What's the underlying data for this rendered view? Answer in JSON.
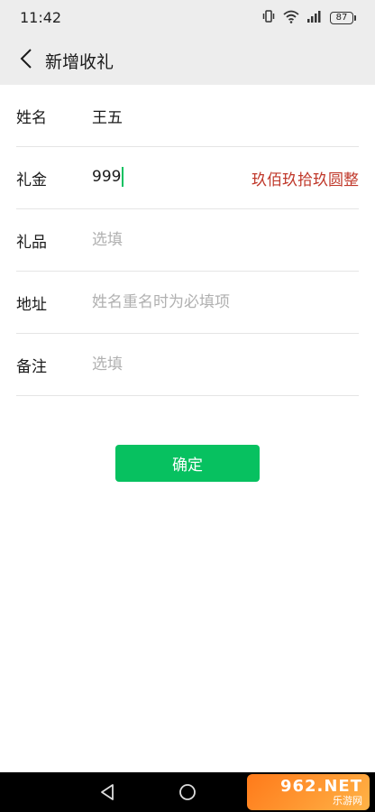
{
  "status_bar": {
    "time": "11:42",
    "battery": "87",
    "icons": [
      "vibrate-icon",
      "wifi-icon",
      "signal-icon"
    ]
  },
  "nav": {
    "title": "新增收礼",
    "back_icon": "chevron-left-icon"
  },
  "form": {
    "name": {
      "label": "姓名",
      "value": "王五",
      "placeholder": ""
    },
    "amount": {
      "label": "礼金",
      "value": "999",
      "words": "玖佰玖拾玖圆整"
    },
    "gift": {
      "label": "礼品",
      "value": "",
      "placeholder": "选填"
    },
    "address": {
      "label": "地址",
      "value": "",
      "placeholder": "姓名重名时为必填项"
    },
    "note": {
      "label": "备注",
      "value": "",
      "placeholder": "选填"
    }
  },
  "confirm": {
    "label": "确定"
  },
  "system_nav": {
    "icons": [
      "back-triangle-icon",
      "home-circle-icon"
    ]
  },
  "watermark": {
    "main": "962.NET",
    "sub": "乐游网"
  },
  "colors": {
    "accent": "#07c160",
    "amount_words": "#c0392b",
    "header_bg": "#ededed"
  }
}
